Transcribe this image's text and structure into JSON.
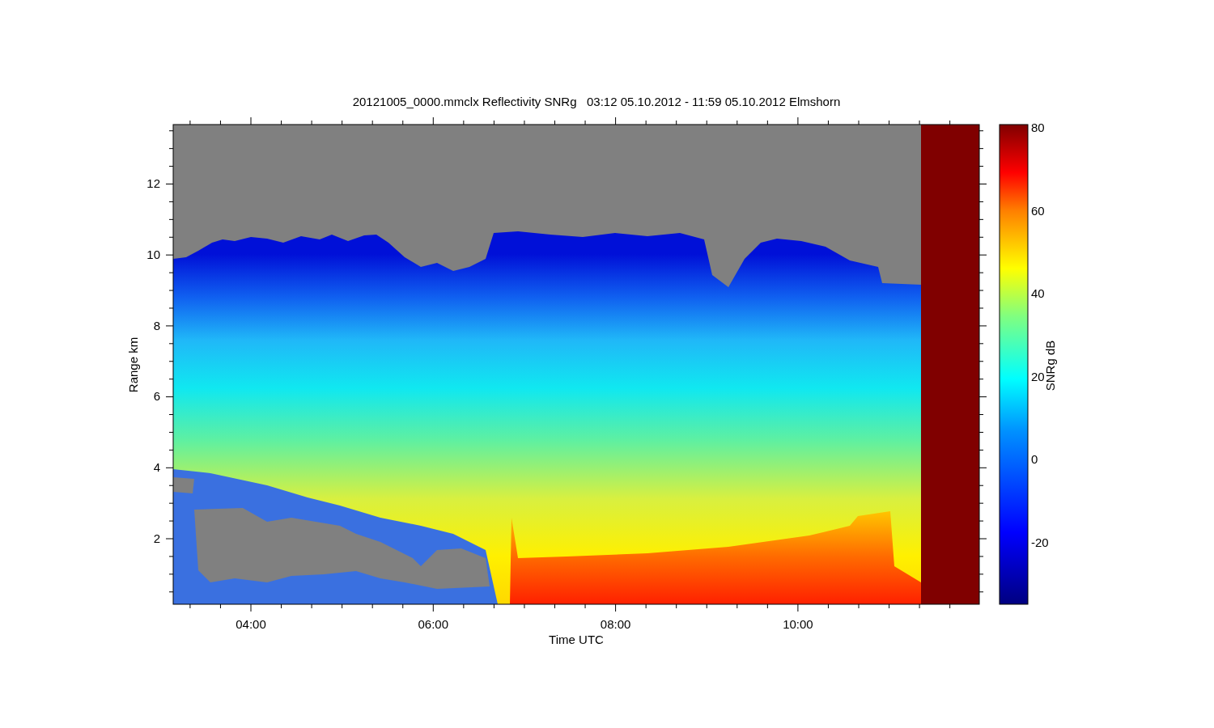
{
  "title": "20121005_0000.mmclx Reflectivity SNRg   03:12 05.10.2012 - 11:59 05.10.2012 Elmshorn",
  "y_axis": {
    "label": "Range km",
    "ticks": [
      "12",
      "10",
      "8",
      "6",
      "4",
      "2"
    ]
  },
  "x_axis": {
    "label": "Time UTC",
    "ticks": [
      "04:00",
      "06:00",
      "08:00",
      "10:00"
    ]
  },
  "colorbar": {
    "label": "SNRg dB",
    "ticks": [
      "80",
      "60",
      "40",
      "20",
      "0",
      "-20"
    ]
  }
}
